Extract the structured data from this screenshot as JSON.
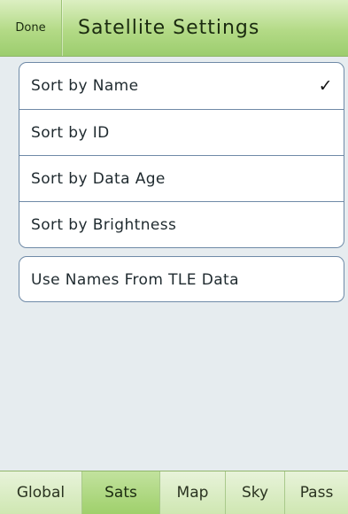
{
  "header": {
    "done_label": "Done",
    "title": "Satellite Settings"
  },
  "sort_options": [
    {
      "label": "Sort by Name",
      "checked": true
    },
    {
      "label": "Sort by ID",
      "checked": false
    },
    {
      "label": "Sort by Data Age",
      "checked": false
    },
    {
      "label": "Sort by Brightness",
      "checked": false
    }
  ],
  "check_mark": "✓",
  "names_option": {
    "label": "Use Names From TLE Data"
  },
  "tabs": [
    {
      "label": "Global",
      "active": false
    },
    {
      "label": "Sats",
      "active": true
    },
    {
      "label": "Map",
      "active": false
    },
    {
      "label": "Sky",
      "active": false
    },
    {
      "label": "Pass",
      "active": false
    }
  ],
  "colors": {
    "header_green": "#b3da86",
    "active_tab_green": "#9fd06b",
    "group_border": "#6f8aa7",
    "background": "#e6ecef"
  }
}
